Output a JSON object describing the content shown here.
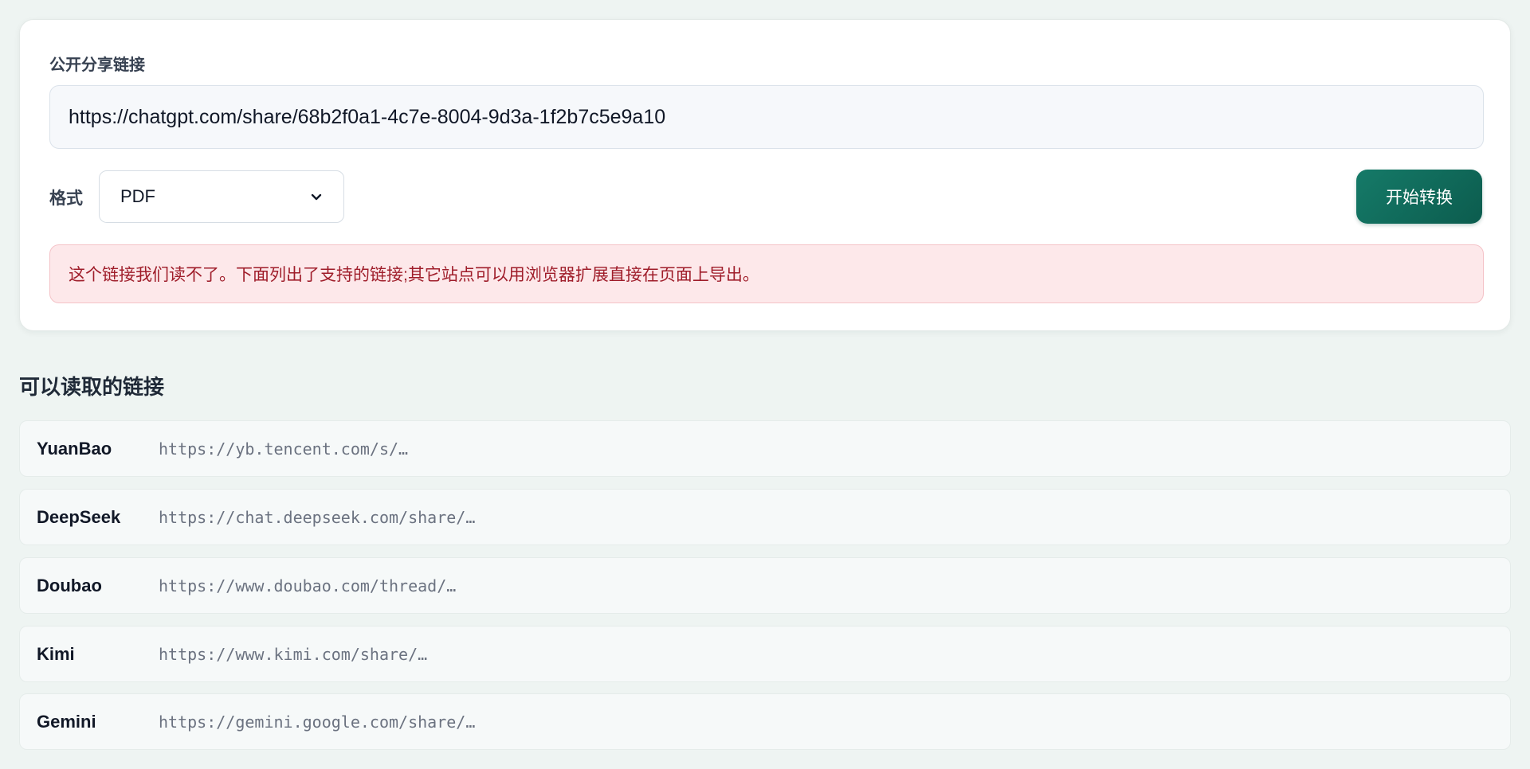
{
  "form": {
    "share_link_label": "公开分享链接",
    "share_link_value": "https://chatgpt.com/share/68b2f0a1-4c7e-8004-9d3a-1f2b7c5e9a10",
    "format_label": "格式",
    "format_selected": "PDF",
    "convert_button": "开始转换",
    "error_message": "这个链接我们读不了。下面列出了支持的链接;其它站点可以用浏览器扩展直接在页面上导出。"
  },
  "supported": {
    "title": "可以读取的链接",
    "sites": [
      {
        "name": "YuanBao",
        "url": "https://yb.tencent.com/s/…"
      },
      {
        "name": "DeepSeek",
        "url": "https://chat.deepseek.com/share/…"
      },
      {
        "name": "Doubao",
        "url": "https://www.doubao.com/thread/…"
      },
      {
        "name": "Kimi",
        "url": "https://www.kimi.com/share/…"
      },
      {
        "name": "Gemini",
        "url": "https://gemini.google.com/share/…"
      }
    ]
  },
  "colors": {
    "accent": "#0f6b5b",
    "error_bg": "#fde8ea",
    "error_text": "#9f1d2a",
    "page_bg": "#eef4f2"
  }
}
